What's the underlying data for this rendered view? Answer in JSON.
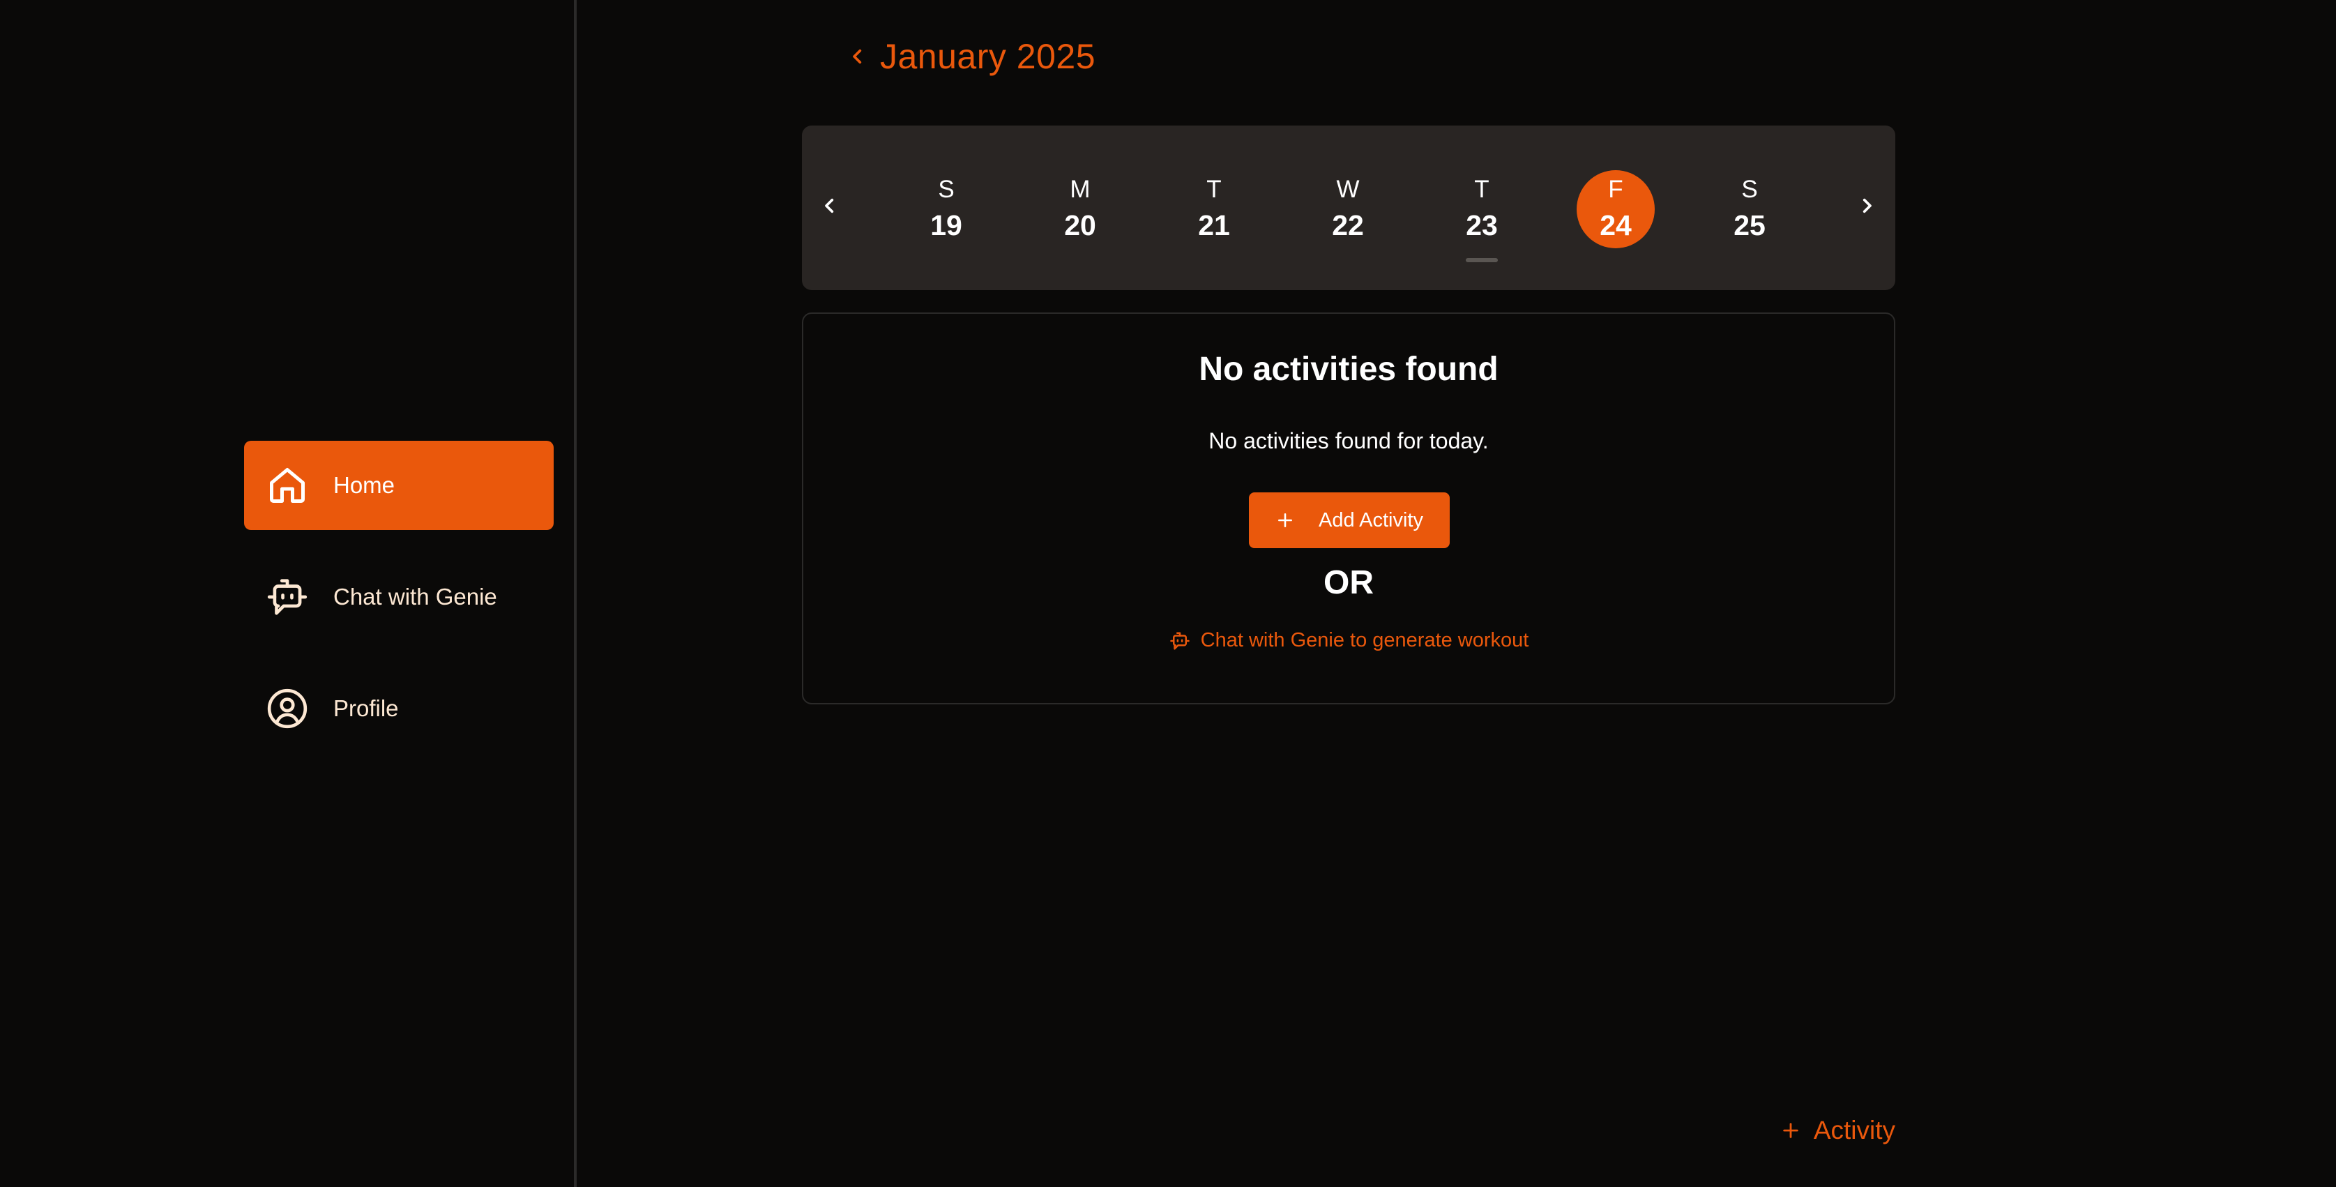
{
  "sidebar": {
    "items": [
      {
        "label": "Home",
        "icon": "home-icon",
        "active": true
      },
      {
        "label": "Chat with Genie",
        "icon": "bot-chat-icon",
        "active": false
      },
      {
        "label": "Profile",
        "icon": "user-circle-icon",
        "active": false
      }
    ]
  },
  "header": {
    "month_title": "January 2025",
    "back_icon": "chevron-left-icon"
  },
  "week": {
    "prev_icon": "chevron-left-icon",
    "next_icon": "chevron-right-icon",
    "days": [
      {
        "dow": "S",
        "num": "19"
      },
      {
        "dow": "M",
        "num": "20"
      },
      {
        "dow": "T",
        "num": "21"
      },
      {
        "dow": "W",
        "num": "22"
      },
      {
        "dow": "T",
        "num": "23"
      },
      {
        "dow": "F",
        "num": "24"
      },
      {
        "dow": "S",
        "num": "25"
      }
    ],
    "selected_index": 5,
    "marked_index": 4
  },
  "empty_state": {
    "title": "No activities found",
    "subtitle": "No activities found for today.",
    "add_button_label": "Add Activity",
    "or_label": "OR",
    "genie_link_label": "Chat with Genie to generate workout"
  },
  "bottom_action": {
    "label": "Activity"
  },
  "colors": {
    "accent": "#ea580c",
    "background": "#0a0908",
    "surface": "#292523",
    "nav_text": "#fde8d3"
  }
}
